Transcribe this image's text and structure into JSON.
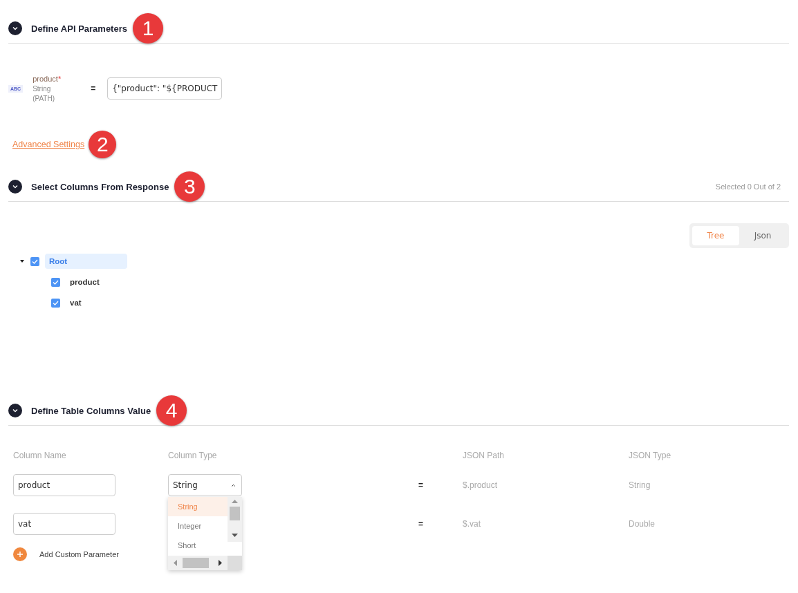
{
  "api_parameters": {
    "title": "Define API Parameters",
    "expanded": true,
    "callout": "1",
    "parameters": [
      {
        "type_tag": "ABC",
        "name": "product",
        "required_mark": "*",
        "data_type": "String",
        "location": "(PATH)",
        "operator": "=",
        "value": "{\"product\": \"${PRODUCT"
      }
    ],
    "advanced_link": "Advanced Settings",
    "advanced_callout": "2"
  },
  "response_columns": {
    "title": "Select Columns From Response",
    "expanded": true,
    "callout": "3",
    "selection_summary": "Selected 0 Out of 2",
    "view_tabs": [
      {
        "label": "Tree",
        "selected": true
      },
      {
        "label": "Json",
        "selected": false
      }
    ],
    "tree": [
      {
        "label": "Root",
        "checked": true,
        "expanded": true,
        "selected": true,
        "children": [
          {
            "label": "product",
            "checked": true,
            "selected": false
          },
          {
            "label": "vat",
            "checked": true,
            "selected": false
          }
        ]
      }
    ]
  },
  "table_columns": {
    "title": "Define Table Columns Value",
    "expanded": true,
    "callout": "4",
    "columns": [
      "Column Name",
      "Column Type",
      "JSON Path",
      "JSON Type"
    ],
    "rows": [
      {
        "name": "product",
        "type": "String",
        "open": true,
        "operator": "=",
        "json_path": "$.product",
        "json_type": "String"
      },
      {
        "name": "vat",
        "operator": "=",
        "json_path": "$.vat",
        "json_type": "Double"
      }
    ],
    "type_options": [
      {
        "label": "String",
        "selected": true
      },
      {
        "label": "Integer",
        "selected": false
      },
      {
        "label": "Short",
        "selected": false
      }
    ],
    "add_button": "Add Custom Parameter"
  }
}
